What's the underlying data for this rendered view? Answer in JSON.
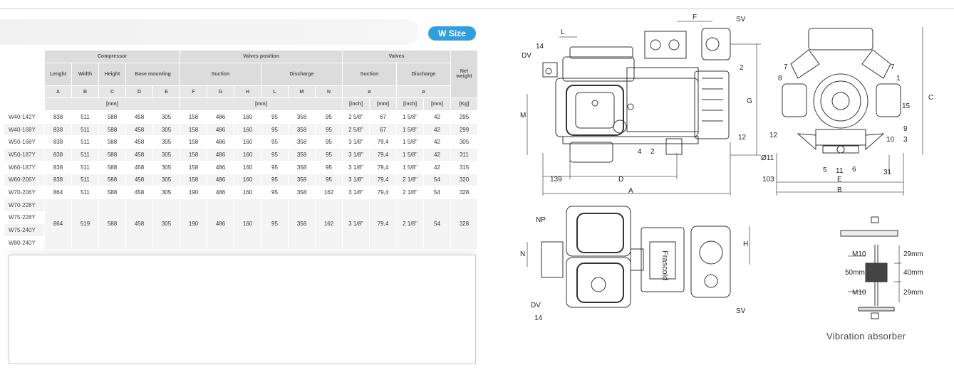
{
  "badge": "W Size",
  "headers": {
    "compressor": "Compressor",
    "valves_position": "Valves position",
    "valves": "Valves",
    "lenght": "Lenght",
    "width": "Width",
    "height": "Height",
    "base_mounting": "Base mounting",
    "suction": "Suction",
    "discharge": "Discharge",
    "vsuction": "Suction",
    "vdischarge": "Discharge",
    "net_weight_1": "Net",
    "net_weight_2": "weight",
    "letters": [
      "A",
      "B",
      "C",
      "D",
      "E",
      "F",
      "G",
      "H",
      "L",
      "M",
      "N",
      "ø",
      "ø"
    ],
    "units": {
      "mm1": "[mm]",
      "mm2": "[mm]",
      "inch1": "[inch]",
      "mm3": "[mm]",
      "inch2": "[inch]",
      "mm4": "[mm]",
      "kg": "[Kg]"
    }
  },
  "rows": [
    {
      "model": "W40-142Y",
      "v": [
        "838",
        "511",
        "588",
        "458",
        "305",
        "158",
        "486",
        "160",
        "95",
        "358",
        "95",
        "2 5/8\"",
        "67",
        "1 5/8\"",
        "42",
        "295"
      ]
    },
    {
      "model": "W40-168Y",
      "v": [
        "838",
        "511",
        "588",
        "458",
        "305",
        "158",
        "486",
        "160",
        "95",
        "358",
        "95",
        "2 5/8\"",
        "67",
        "1 5/8\"",
        "42",
        "299"
      ]
    },
    {
      "model": "W50-168Y",
      "v": [
        "838",
        "511",
        "588",
        "458",
        "305",
        "158",
        "486",
        "160",
        "95",
        "358",
        "95",
        "3 1/8\"",
        "79,4",
        "1 5/8\"",
        "42",
        "305"
      ]
    },
    {
      "model": "W50-187Y",
      "v": [
        "838",
        "511",
        "588",
        "458",
        "305",
        "158",
        "486",
        "160",
        "95",
        "358",
        "95",
        "3 1/8\"",
        "79,4",
        "1 5/8\"",
        "42",
        "311"
      ]
    },
    {
      "model": "W60-187Y",
      "v": [
        "838",
        "511",
        "588",
        "458",
        "305",
        "158",
        "486",
        "160",
        "95",
        "358",
        "95",
        "3 1/8\"",
        "79,4",
        "1 5/8\"",
        "42",
        "315"
      ]
    },
    {
      "model": "W60-206Y",
      "v": [
        "838",
        "511",
        "588",
        "458",
        "305",
        "158",
        "486",
        "160",
        "95",
        "358",
        "95",
        "3 1/8\"",
        "79,4",
        "2 1/8\"",
        "54",
        "320"
      ]
    },
    {
      "model": "W70-206Y",
      "v": [
        "864",
        "511",
        "588",
        "458",
        "305",
        "190",
        "486",
        "160",
        "95",
        "358",
        "162",
        "3 1/8\"",
        "79,4",
        "2 1/8\"",
        "54",
        "328"
      ]
    }
  ],
  "group": {
    "models": [
      "W70-228Y",
      "W75-228Y",
      "W75-240Y",
      "W80-240Y"
    ],
    "v": [
      "864",
      "519",
      "588",
      "458",
      "305",
      "190",
      "486",
      "160",
      "95",
      "358",
      "162",
      "3 1/8\"",
      "79,4",
      "2 1/8\"",
      "54",
      "328"
    ]
  },
  "drawing": {
    "side_labels": [
      "F",
      "SV",
      "L",
      "14",
      "DV",
      "2",
      "M",
      "G",
      "C",
      "4",
      "2",
      "12",
      "139",
      "D",
      "A"
    ],
    "front_labels": [
      "7",
      "7",
      "8",
      "1",
      "15",
      "12",
      "9",
      "10",
      "3",
      "Ø11",
      "5",
      "11",
      "6",
      "103",
      "31",
      "E",
      "B"
    ],
    "top_labels": [
      "NP",
      "N",
      "H",
      "DV",
      "14",
      "SV"
    ],
    "absorber_labels": [
      "M10",
      "29mm",
      "50mm",
      "40mm",
      "M10",
      "29mm"
    ],
    "absorber_title": "Vibration absorber",
    "nameplate": "Frascold"
  }
}
